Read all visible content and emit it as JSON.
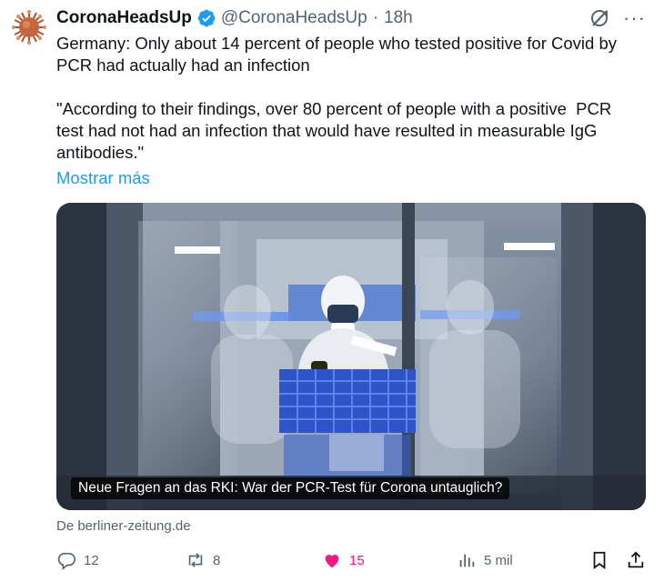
{
  "tweet": {
    "display_name": "CoronaHeadsUp",
    "handle": "@CoronaHeadsUp",
    "separator": "·",
    "time": "18h",
    "text_line_1": "Germany: Only about 14 percent of people who tested positive for Covid by",
    "text_line_2": "PCR had actually had an infection",
    "quote_line_1": "\"According to their findings, over 80 percent of people with a positive  PCR",
    "quote_line_2": "test had not had an infection that would have resulted in measurable IgG",
    "quote_line_3": "antibodies.\"",
    "show_more": "Mostrar más"
  },
  "card": {
    "caption": "Neue Fragen an das RKI: War der PCR-Test für Corona untauglich?",
    "source": "De berliner-zeitung.de"
  },
  "actions": {
    "replies": "12",
    "retweets": "8",
    "likes": "15",
    "views": "5 mil"
  },
  "colors": {
    "accent": "#1d9bf0",
    "like": "#f91880",
    "muted": "#536471"
  },
  "icons": [
    "avatar-virus",
    "verified-badge-icon",
    "grok-icon",
    "more-icon",
    "reply-icon",
    "retweet-icon",
    "like-icon",
    "views-icon",
    "bookmark-icon",
    "share-icon"
  ]
}
